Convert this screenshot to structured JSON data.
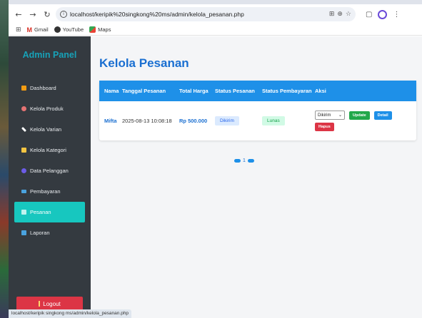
{
  "browser": {
    "url": "localhost/keripik%20singkong%20ms/admin/kelola_pesanan.php",
    "bookmarks": [
      "Gmail",
      "YouTube",
      "Maps"
    ],
    "status_url": "localhost/keripik singkong ms/admin/kelola_pesanan.php"
  },
  "sidebar": {
    "title": "Admin Panel",
    "items": [
      {
        "label": "Dashboard",
        "color": "#f39c12"
      },
      {
        "label": "Kelola Produk",
        "color": "#e57373"
      },
      {
        "label": "Kelola Varian",
        "color": "#ffffff"
      },
      {
        "label": "Kelola Kategori",
        "color": "#f4c542"
      },
      {
        "label": "Data Pelanggan",
        "color": "#6c5ce7"
      },
      {
        "label": "Pembayaran",
        "color": "#4aa3df"
      },
      {
        "label": "Pesanan",
        "color": "#ffffff"
      },
      {
        "label": "Laporan",
        "color": "#4aa3df"
      }
    ],
    "logout": "Logout"
  },
  "main": {
    "title": "Kelola Pesanan",
    "columns": [
      "Nama",
      "Tanggal Pesanan",
      "Total Harga",
      "Status Pesanan",
      "Status Pembayaran",
      "Aksi"
    ],
    "rows": [
      {
        "nama": "Mifta",
        "tanggal": "2025-08-13 10:08:18",
        "total": "Rp 500.000",
        "status_pesanan": "Dikirim",
        "status_pembayaran": "Lunas",
        "select_value": "Dikirim",
        "update": "Update",
        "detail": "Detail",
        "hapus": "Hapus"
      }
    ],
    "page": "1"
  }
}
